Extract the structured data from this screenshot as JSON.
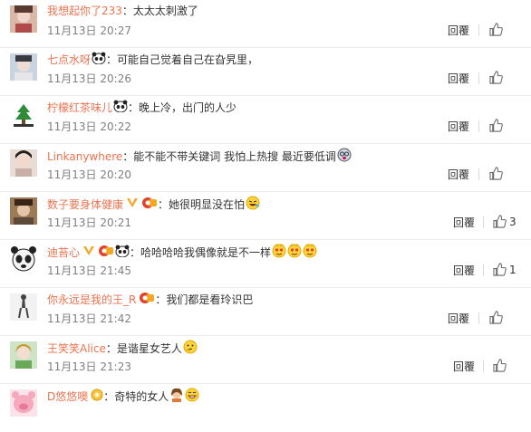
{
  "reply_label": "回覆",
  "comments": [
    {
      "name": "我想起你了233",
      "text": "太太太刺激了",
      "date": "11月13日",
      "time": "20:27",
      "likes": ""
    },
    {
      "name": "七点水呀",
      "text": "可能自己觉着自己在旮旯里，",
      "date": "11月13日",
      "time": "20:26",
      "likes": ""
    },
    {
      "name": "柠檬红茶味儿",
      "text": "晚上冷，出门的人少",
      "date": "11月13日",
      "time": "20:22",
      "likes": ""
    },
    {
      "name": "Linkanywhere",
      "text": "能不能不带关键词 我怕上热搜 最近要低调",
      "date": "11月13日",
      "time": "20:20",
      "likes": ""
    },
    {
      "name": "数子要身体健康",
      "text": "她很明显没在怕",
      "date": "11月13日",
      "time": "20:21",
      "likes": "3"
    },
    {
      "name": "迪苔心",
      "text": "哈哈哈哈我偶像就是不一样",
      "date": "11月13日",
      "time": "21:45",
      "likes": "1"
    },
    {
      "name": "你永远是我的王_R",
      "text": "我们都是看玲识巴",
      "date": "11月13日",
      "time": "21:42",
      "likes": ""
    },
    {
      "name": "王笑笑Alice",
      "text": "是谐星女艺人",
      "date": "11月13日",
      "time": "21:23",
      "likes": ""
    },
    {
      "name": "D悠悠噢",
      "text": "奇特的女人",
      "date": "",
      "time": "",
      "likes": ""
    }
  ],
  "colors": {
    "name": "#eb7350",
    "accent_vip": "#f5a623",
    "badge_red": "#e0422b"
  }
}
